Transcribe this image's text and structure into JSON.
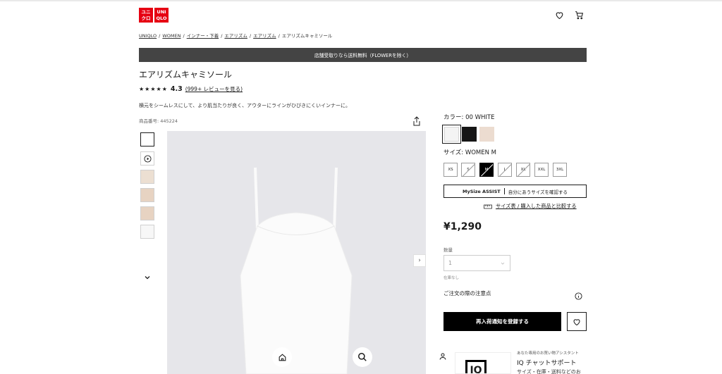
{
  "header": {
    "logo": {
      "top_left": "ユニ",
      "top_right": "UNI",
      "bottom_left": "クロ",
      "bottom_right": "QLO",
      "color": "#e60012"
    },
    "icons": [
      "heart-icon",
      "cart-icon"
    ]
  },
  "breadcrumb": {
    "items": [
      "UNIQLO",
      "WOMEN",
      "インナー・下着",
      "エアリズム",
      "エアリズム"
    ],
    "current": "エアリズムキャミソール",
    "separator": "/"
  },
  "banner": {
    "text": "店舗受取りなら送料無料（FLOWERを除く）"
  },
  "product": {
    "title": "エアリズムキャミソール",
    "stars": "★★★★★",
    "rating": "4.3",
    "reviews": "(999+ レビューを見る)",
    "description": "横元をシームレスにして、より肌当たりが良く、アウターにラインがひびきにくいインナーに。",
    "product_no": "商品番号: 445224"
  },
  "options": {
    "color_label": "カラー:",
    "color_value": "00 WHITE",
    "colors": [
      "#f4f4f4",
      "#161616",
      "#ecdcd0"
    ],
    "size_label": "サイズ:",
    "size_value": "WOMEN M",
    "sizes": [
      "XS",
      "S",
      "M",
      "L",
      "XL",
      "XXL",
      "3XL"
    ],
    "mysize_brand": "MySize ASSIST",
    "mysize_text": "自分にあうサイズを確認する",
    "sizechart": "サイズ表 / 購入した商品と比較する"
  },
  "price": "¥1,290",
  "quantity": {
    "label": "数量",
    "value": "1",
    "stock": "在庫なし"
  },
  "notes": "ご注文の際の注意点",
  "notify_button": "再入荷通知を登録する",
  "iq": {
    "logo": "IQ",
    "caption": "あなた専用のお買い物アシスタント",
    "title": "IQ チャットサポート",
    "subtitle": "サイズ・在庫・送料などのお"
  }
}
